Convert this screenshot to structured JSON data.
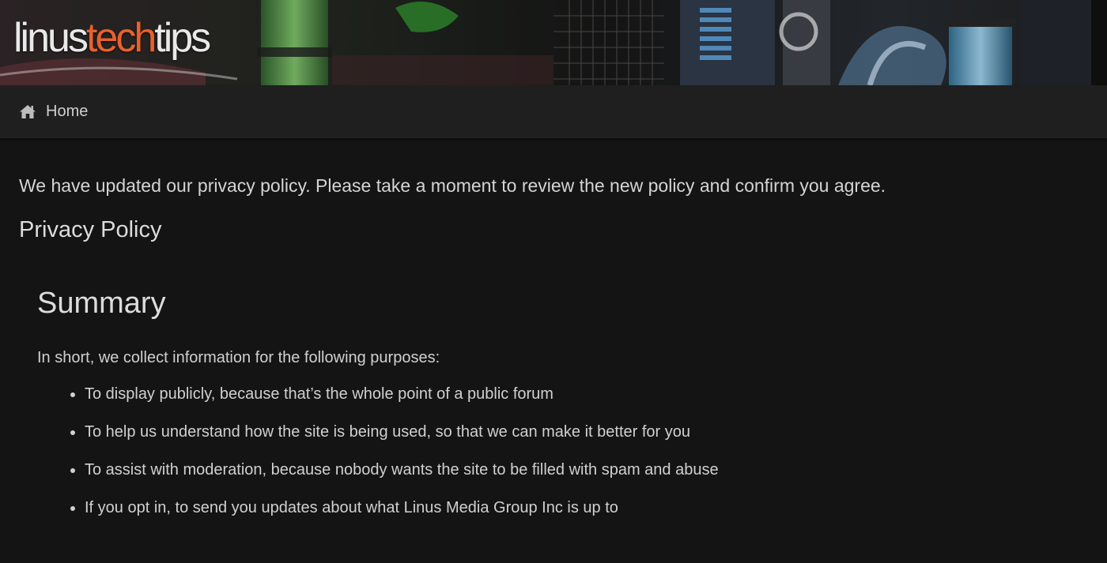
{
  "header": {
    "logo": {
      "part1": "linus",
      "part2": "tech",
      "part3": "tips"
    },
    "brand_color": "#e8612c"
  },
  "nav": {
    "home_icon": "home-icon",
    "home_label": "Home"
  },
  "content": {
    "notice": "We have updated our privacy policy. Please take a moment to review the new policy and confirm you agree.",
    "policy_title": "Privacy Policy",
    "summary_heading": "Summary",
    "intro": "In short, we collect information for the following purposes:",
    "purposes": [
      "To display publicly, because that’s the whole point of a public forum",
      "To help us understand how the site is being used, so that we can make it better for you",
      "To assist with moderation, because nobody wants the site to be filled with spam and abuse",
      "If you opt in, to send you updates about what Linus Media Group Inc is up to"
    ]
  }
}
